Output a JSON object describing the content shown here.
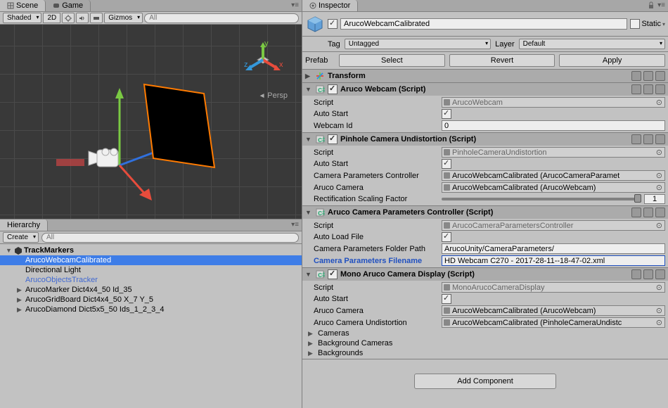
{
  "scene_tab": "Scene",
  "game_tab": "Game",
  "hierarchy_tab": "Hierarchy",
  "inspector_tab": "Inspector",
  "scene_toolbar": {
    "shading": "Shaded",
    "btn2d": "2D",
    "gizmos": "Gizmos",
    "search_placeholder": "All"
  },
  "persp_label": "Persp",
  "hierarchy": {
    "create": "Create",
    "search_placeholder": "All",
    "scene": "TrackMarkers",
    "items": [
      {
        "label": "ArucoWebcamCalibrated",
        "selected": true,
        "indent": 1
      },
      {
        "label": "Directional Light",
        "indent": 1
      },
      {
        "label": "ArucoObjectsTracker",
        "indent": 1,
        "prefab": true
      },
      {
        "label": "ArucoMarker Dict4x4_50 Id_35",
        "indent": 1,
        "arrow": true
      },
      {
        "label": "ArucoGridBoard Dict4x4_50 X_7 Y_5",
        "indent": 1,
        "arrow": true
      },
      {
        "label": "ArucoDiamond Dict5x5_50 Ids_1_2_3_4",
        "indent": 1,
        "arrow": true
      }
    ]
  },
  "inspector": {
    "name": "ArucoWebcamCalibrated",
    "enabled": true,
    "static_label": "Static",
    "tag_label": "Tag",
    "tag_value": "Untagged",
    "layer_label": "Layer",
    "layer_value": "Default",
    "prefab_label": "Prefab",
    "prefab_select": "Select",
    "prefab_revert": "Revert",
    "prefab_apply": "Apply",
    "transform": "Transform",
    "components": [
      {
        "title": "Aruco Webcam (Script)",
        "enabled": true,
        "props": [
          {
            "label": "Script",
            "type": "obj-ro",
            "value": "ArucoWebcam"
          },
          {
            "label": "Auto Start",
            "type": "check",
            "checked": true
          },
          {
            "label": "Webcam Id",
            "type": "text",
            "value": "0"
          }
        ]
      },
      {
        "title": "Pinhole Camera Undistortion (Script)",
        "enabled": true,
        "props": [
          {
            "label": "Script",
            "type": "obj-ro",
            "value": "PinholeCameraUndistortion"
          },
          {
            "label": "Auto Start",
            "type": "check",
            "checked": true
          },
          {
            "label": "Camera Parameters Controller",
            "type": "obj",
            "value": "ArucoWebcamCalibrated (ArucoCameraParamet"
          },
          {
            "label": "Aruco Camera",
            "type": "obj",
            "value": "ArucoWebcamCalibrated (ArucoWebcam)"
          },
          {
            "label": "Rectification Scaling Factor",
            "type": "slider",
            "value": "1"
          }
        ]
      },
      {
        "title": "Aruco Camera Parameters Controller (Script)",
        "noCheckbox": true,
        "props": [
          {
            "label": "Script",
            "type": "obj-ro",
            "value": "ArucoCameraParametersController"
          },
          {
            "label": "Auto Load File",
            "type": "check",
            "checked": true
          },
          {
            "label": "Camera Parameters Folder Path",
            "type": "text",
            "value": "ArucoUnity/CameraParameters/"
          },
          {
            "label": "Camera Parameters Filename",
            "type": "text-active",
            "value": "HD Webcam C270 - 2017-28-11--18-47-02.xml"
          }
        ]
      },
      {
        "title": "Mono Aruco Camera Display (Script)",
        "enabled": true,
        "props": [
          {
            "label": "Script",
            "type": "obj-ro",
            "value": "MonoArucoCameraDisplay"
          },
          {
            "label": "Auto Start",
            "type": "check",
            "checked": true
          },
          {
            "label": "Aruco Camera",
            "type": "obj",
            "value": "ArucoWebcamCalibrated (ArucoWebcam)"
          },
          {
            "label": "Aruco Camera Undistortion",
            "type": "obj",
            "value": "ArucoWebcamCalibrated (PinholeCameraUndistc"
          }
        ],
        "subitems": [
          "Cameras",
          "Background Cameras",
          "Backgrounds"
        ]
      }
    ],
    "add_component": "Add Component"
  }
}
